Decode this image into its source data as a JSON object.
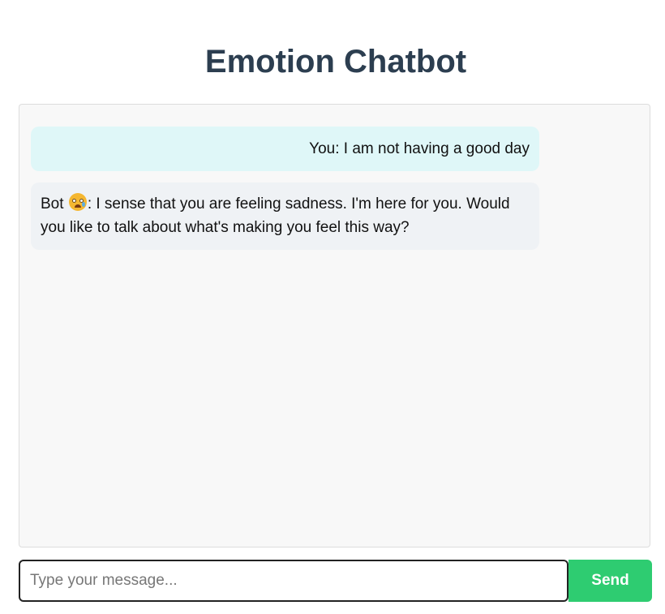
{
  "header": {
    "title": "Emotion Chatbot"
  },
  "chat": {
    "messages": [
      {
        "sender": "user",
        "text": "You: I am not having a good day"
      },
      {
        "sender": "bot",
        "prefix": "Bot",
        "emoji_icon": "sad-face-emoji-icon",
        "text": ": I sense that you are feeling sadness. I'm here for you. Would you like to talk about what's making you feel this way?"
      }
    ]
  },
  "composer": {
    "placeholder": "Type your message...",
    "value": "",
    "send_label": "Send"
  },
  "colors": {
    "title": "#2c3e50",
    "user_bubble": "#dff7f8",
    "bot_bubble": "#eff2f5",
    "chat_background": "#f8f8f8",
    "send_button": "#2ecc71"
  }
}
